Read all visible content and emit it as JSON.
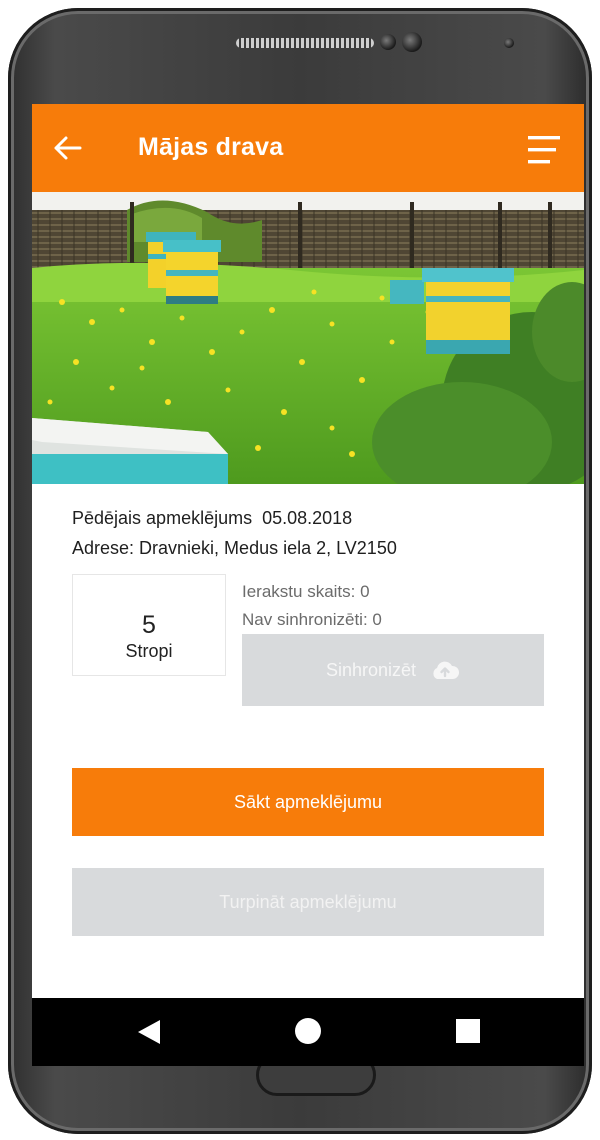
{
  "app": {
    "title": "Mājas drava",
    "accent_color": "#f77c0a",
    "disabled_color": "#d8dadc",
    "back_icon": "arrow-left-icon",
    "menu_icon": "menu-icon"
  },
  "apiary": {
    "last_visit_label": "Pēdējais apmeklējums",
    "last_visit_date": "05.08.2018",
    "address": "Adrese: Dravnieki, Medus iela 2, LV2150",
    "hive_count": "5",
    "hive_label": "Stropi",
    "records_count": "Ierakstu skaits: 0",
    "unsynced": "Nav sinhronizēti: 0"
  },
  "buttons": {
    "sync_label": "Sinhronizēt",
    "sync_icon": "cloud-upload-icon",
    "start_visit": "Sākt apmeklējumu",
    "continue_visit": "Turpināt apmeklējumu"
  },
  "nav": {
    "back_icon": "nav-back-icon",
    "home_icon": "nav-home-icon",
    "recent_icon": "nav-recents-icon"
  }
}
